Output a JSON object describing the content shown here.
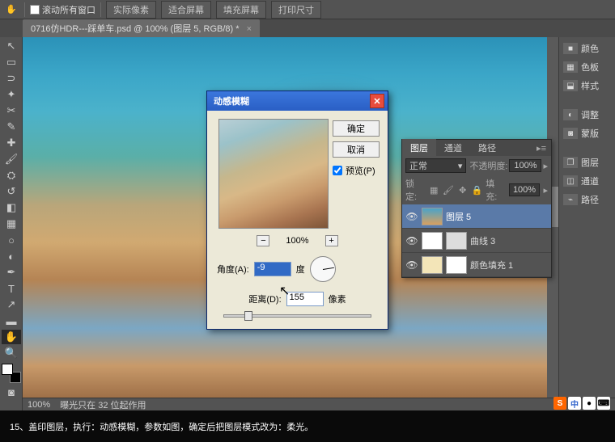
{
  "toolbar": {
    "scroll_all": "滚动所有窗口",
    "btn_actual": "实际像素",
    "btn_fit": "适合屏幕",
    "btn_fill": "填充屏幕",
    "btn_print": "打印尺寸"
  },
  "tab": {
    "title": "0716仿HDR---踩单车.psd @ 100% (图层 5, RGB/8) *"
  },
  "dialog": {
    "title": "动感模糊",
    "ok": "确定",
    "cancel": "取消",
    "preview": "预览(P)",
    "zoom": "100%",
    "angle_label": "角度(A):",
    "angle_value": "-9",
    "angle_unit": "度",
    "distance_label": "距离(D):",
    "distance_value": "155",
    "distance_unit": "像素"
  },
  "layers_panel": {
    "tab_layer": "图层",
    "tab_channel": "通道",
    "tab_path": "路径",
    "blend_mode": "正常",
    "opacity_label": "不透明度:",
    "opacity_value": "100%",
    "lock_label": "锁定:",
    "fill_label": "填充:",
    "fill_value": "100%",
    "layers": [
      {
        "name": "图层 5"
      },
      {
        "name": "曲线 3"
      },
      {
        "name": "颜色填充 1"
      }
    ]
  },
  "dock": {
    "color": "颜色",
    "swatch": "色板",
    "styles": "样式",
    "adjust": "调整",
    "mask": "蒙版",
    "layers": "图层",
    "channels": "通道",
    "paths": "路径"
  },
  "status": {
    "zoom": "100%",
    "info": "曝光只在 32 位起作用"
  },
  "caption": "15、盖印图层，执行：动感模糊，参数如图，确定后把图层模式改为：柔光。"
}
